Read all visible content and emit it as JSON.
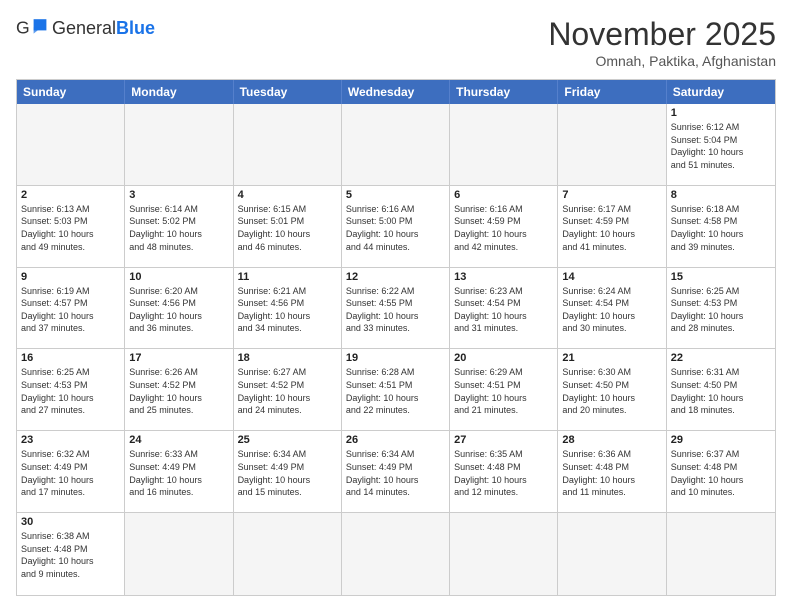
{
  "header": {
    "logo_general": "General",
    "logo_blue": "Blue",
    "month": "November 2025",
    "location": "Omnah, Paktika, Afghanistan"
  },
  "weekdays": [
    "Sunday",
    "Monday",
    "Tuesday",
    "Wednesday",
    "Thursday",
    "Friday",
    "Saturday"
  ],
  "cells": [
    {
      "day": "",
      "info": "",
      "empty": true
    },
    {
      "day": "",
      "info": "",
      "empty": true
    },
    {
      "day": "",
      "info": "",
      "empty": true
    },
    {
      "day": "",
      "info": "",
      "empty": true
    },
    {
      "day": "",
      "info": "",
      "empty": true
    },
    {
      "day": "",
      "info": "",
      "empty": true
    },
    {
      "day": "1",
      "info": "Sunrise: 6:12 AM\nSunset: 5:04 PM\nDaylight: 10 hours\nand 51 minutes."
    },
    {
      "day": "2",
      "info": "Sunrise: 6:13 AM\nSunset: 5:03 PM\nDaylight: 10 hours\nand 49 minutes."
    },
    {
      "day": "3",
      "info": "Sunrise: 6:14 AM\nSunset: 5:02 PM\nDaylight: 10 hours\nand 48 minutes."
    },
    {
      "day": "4",
      "info": "Sunrise: 6:15 AM\nSunset: 5:01 PM\nDaylight: 10 hours\nand 46 minutes."
    },
    {
      "day": "5",
      "info": "Sunrise: 6:16 AM\nSunset: 5:00 PM\nDaylight: 10 hours\nand 44 minutes."
    },
    {
      "day": "6",
      "info": "Sunrise: 6:16 AM\nSunset: 4:59 PM\nDaylight: 10 hours\nand 42 minutes."
    },
    {
      "day": "7",
      "info": "Sunrise: 6:17 AM\nSunset: 4:59 PM\nDaylight: 10 hours\nand 41 minutes."
    },
    {
      "day": "8",
      "info": "Sunrise: 6:18 AM\nSunset: 4:58 PM\nDaylight: 10 hours\nand 39 minutes."
    },
    {
      "day": "9",
      "info": "Sunrise: 6:19 AM\nSunset: 4:57 PM\nDaylight: 10 hours\nand 37 minutes."
    },
    {
      "day": "10",
      "info": "Sunrise: 6:20 AM\nSunset: 4:56 PM\nDaylight: 10 hours\nand 36 minutes."
    },
    {
      "day": "11",
      "info": "Sunrise: 6:21 AM\nSunset: 4:56 PM\nDaylight: 10 hours\nand 34 minutes."
    },
    {
      "day": "12",
      "info": "Sunrise: 6:22 AM\nSunset: 4:55 PM\nDaylight: 10 hours\nand 33 minutes."
    },
    {
      "day": "13",
      "info": "Sunrise: 6:23 AM\nSunset: 4:54 PM\nDaylight: 10 hours\nand 31 minutes."
    },
    {
      "day": "14",
      "info": "Sunrise: 6:24 AM\nSunset: 4:54 PM\nDaylight: 10 hours\nand 30 minutes."
    },
    {
      "day": "15",
      "info": "Sunrise: 6:25 AM\nSunset: 4:53 PM\nDaylight: 10 hours\nand 28 minutes."
    },
    {
      "day": "16",
      "info": "Sunrise: 6:25 AM\nSunset: 4:53 PM\nDaylight: 10 hours\nand 27 minutes."
    },
    {
      "day": "17",
      "info": "Sunrise: 6:26 AM\nSunset: 4:52 PM\nDaylight: 10 hours\nand 25 minutes."
    },
    {
      "day": "18",
      "info": "Sunrise: 6:27 AM\nSunset: 4:52 PM\nDaylight: 10 hours\nand 24 minutes."
    },
    {
      "day": "19",
      "info": "Sunrise: 6:28 AM\nSunset: 4:51 PM\nDaylight: 10 hours\nand 22 minutes."
    },
    {
      "day": "20",
      "info": "Sunrise: 6:29 AM\nSunset: 4:51 PM\nDaylight: 10 hours\nand 21 minutes."
    },
    {
      "day": "21",
      "info": "Sunrise: 6:30 AM\nSunset: 4:50 PM\nDaylight: 10 hours\nand 20 minutes."
    },
    {
      "day": "22",
      "info": "Sunrise: 6:31 AM\nSunset: 4:50 PM\nDaylight: 10 hours\nand 18 minutes."
    },
    {
      "day": "23",
      "info": "Sunrise: 6:32 AM\nSunset: 4:49 PM\nDaylight: 10 hours\nand 17 minutes."
    },
    {
      "day": "24",
      "info": "Sunrise: 6:33 AM\nSunset: 4:49 PM\nDaylight: 10 hours\nand 16 minutes."
    },
    {
      "day": "25",
      "info": "Sunrise: 6:34 AM\nSunset: 4:49 PM\nDaylight: 10 hours\nand 15 minutes."
    },
    {
      "day": "26",
      "info": "Sunrise: 6:34 AM\nSunset: 4:49 PM\nDaylight: 10 hours\nand 14 minutes."
    },
    {
      "day": "27",
      "info": "Sunrise: 6:35 AM\nSunset: 4:48 PM\nDaylight: 10 hours\nand 12 minutes."
    },
    {
      "day": "28",
      "info": "Sunrise: 6:36 AM\nSunset: 4:48 PM\nDaylight: 10 hours\nand 11 minutes."
    },
    {
      "day": "29",
      "info": "Sunrise: 6:37 AM\nSunset: 4:48 PM\nDaylight: 10 hours\nand 10 minutes."
    },
    {
      "day": "30",
      "info": "Sunrise: 6:38 AM\nSunset: 4:48 PM\nDaylight: 10 hours\nand 9 minutes."
    },
    {
      "day": "",
      "info": "",
      "empty": true
    },
    {
      "day": "",
      "info": "",
      "empty": true
    },
    {
      "day": "",
      "info": "",
      "empty": true
    },
    {
      "day": "",
      "info": "",
      "empty": true
    },
    {
      "day": "",
      "info": "",
      "empty": true
    },
    {
      "day": "",
      "info": "",
      "empty": true
    }
  ]
}
